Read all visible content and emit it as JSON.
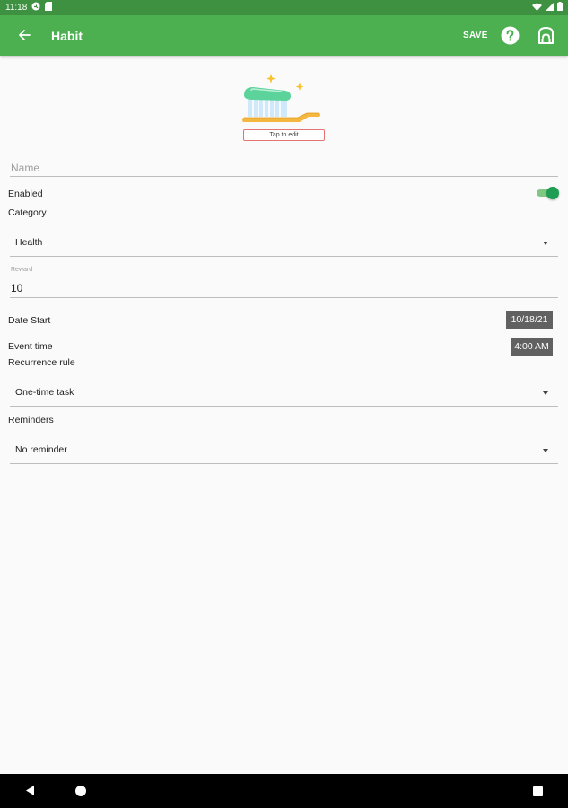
{
  "status_bar": {
    "time": "11:18"
  },
  "app_bar": {
    "title": "Habit",
    "save_label": "SAVE"
  },
  "hero": {
    "icon": "toothbrush-icon",
    "tap_label": "Tap to edit"
  },
  "form": {
    "name": {
      "placeholder": "Name",
      "value": ""
    },
    "enabled": {
      "label": "Enabled",
      "checked": true
    },
    "category": {
      "label": "Category",
      "value": "Health"
    },
    "reward": {
      "label": "Reward",
      "value": "10"
    },
    "date_start": {
      "label": "Date Start",
      "value": "10/18/21"
    },
    "event_time": {
      "label": "Event time",
      "value": "4:00 AM"
    },
    "recurrence": {
      "label": "Recurrence rule",
      "value": "One-time task"
    },
    "reminders": {
      "label": "Reminders",
      "value": "No reminder"
    }
  },
  "colors": {
    "app_bar": "#4caf50",
    "status_bar": "#3d9140",
    "switch_on": "#1e9e52",
    "chip": "#616161"
  }
}
